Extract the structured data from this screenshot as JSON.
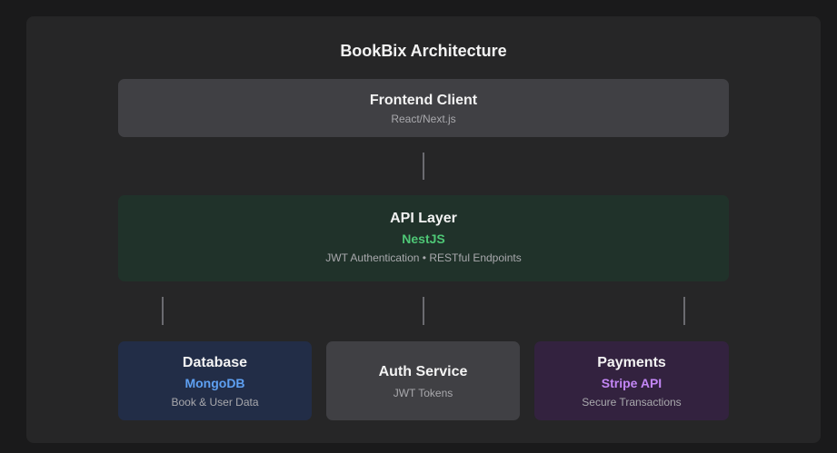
{
  "diagram": {
    "title": "BookBix Architecture",
    "frontend": {
      "name": "Frontend Client",
      "desc": "React/Next.js"
    },
    "api": {
      "name": "API Layer",
      "tech": "NestJS",
      "desc": "JWT Authentication • RESTful Endpoints"
    },
    "services": [
      {
        "name": "Database",
        "tech": "MongoDB",
        "desc": "Book & User Data"
      },
      {
        "name": "Auth Service",
        "desc": "JWT Tokens"
      },
      {
        "name": "Payments",
        "tech": "Stripe API",
        "desc": "Secure Transactions"
      }
    ]
  },
  "colors": {
    "page_background": "#1a1a1b",
    "panel_background": "#262627",
    "frontend_box": "#404044",
    "api_box": "#20322a",
    "api_accent": "#4ec776",
    "database_box": "#222d47",
    "database_accent": "#5ea0f2",
    "auth_box": "#404044",
    "payments_box": "#33223f",
    "payments_accent": "#c386f5",
    "connector": "#6b6b70"
  }
}
